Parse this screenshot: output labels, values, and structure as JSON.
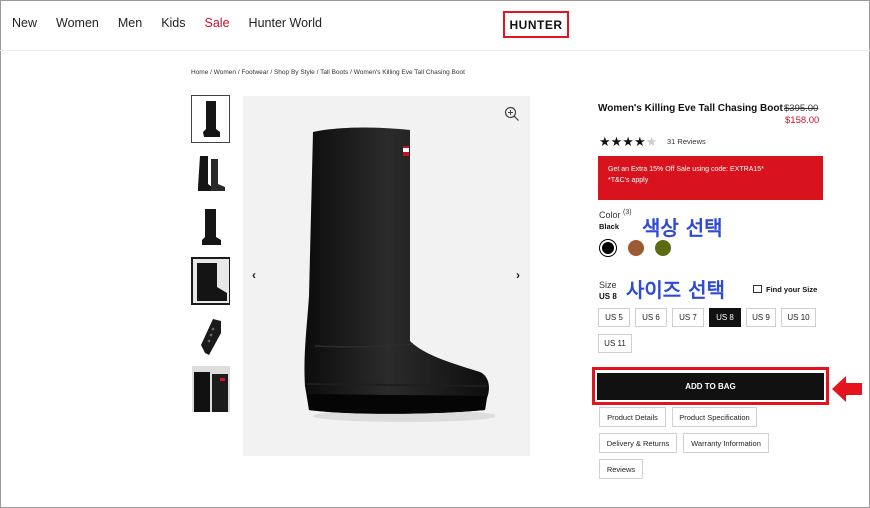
{
  "nav": {
    "items": [
      "New",
      "Women",
      "Men",
      "Kids",
      "Sale",
      "Hunter World"
    ],
    "logo": "HUNTER"
  },
  "breadcrumb": "Home / Women / Footwear / Shop By Style / Tall Boots / Women's Killing Eve Tall Chasing Boot",
  "product": {
    "title": "Women's Killing Eve Tall Chasing Boot",
    "old_price": "$395.00",
    "new_price": "$158.00",
    "rating_stars": 4,
    "rating_max": 5,
    "reviews": "31 Reviews",
    "promo_line1": "Get an Extra 15% Off Sale using code: EXTRA15*",
    "promo_line2": "*T&C's apply",
    "color_label": "Color",
    "color_count": "(3)",
    "color_selected": "Black",
    "colors": [
      "#000000",
      "#9c5b32",
      "#5c6b11"
    ],
    "size_label": "Size",
    "size_selected": "US 8",
    "find_size": "Find your Size",
    "sizes": [
      "US 5",
      "US 6",
      "US 7",
      "US 8",
      "US 9",
      "US 10",
      "US 11"
    ],
    "add_to_bag": "ADD TO BAG",
    "info_buttons": [
      "Product Details",
      "Product Specification",
      "Delivery & Returns",
      "Warranty Information",
      "Reviews"
    ]
  },
  "annotations": {
    "color_note": "색상 선택",
    "size_note": "사이즈 선택",
    "accent": "#e5131d",
    "note_color": "#2e4bd6"
  },
  "gallery": {
    "prev": "‹",
    "next": "›"
  }
}
